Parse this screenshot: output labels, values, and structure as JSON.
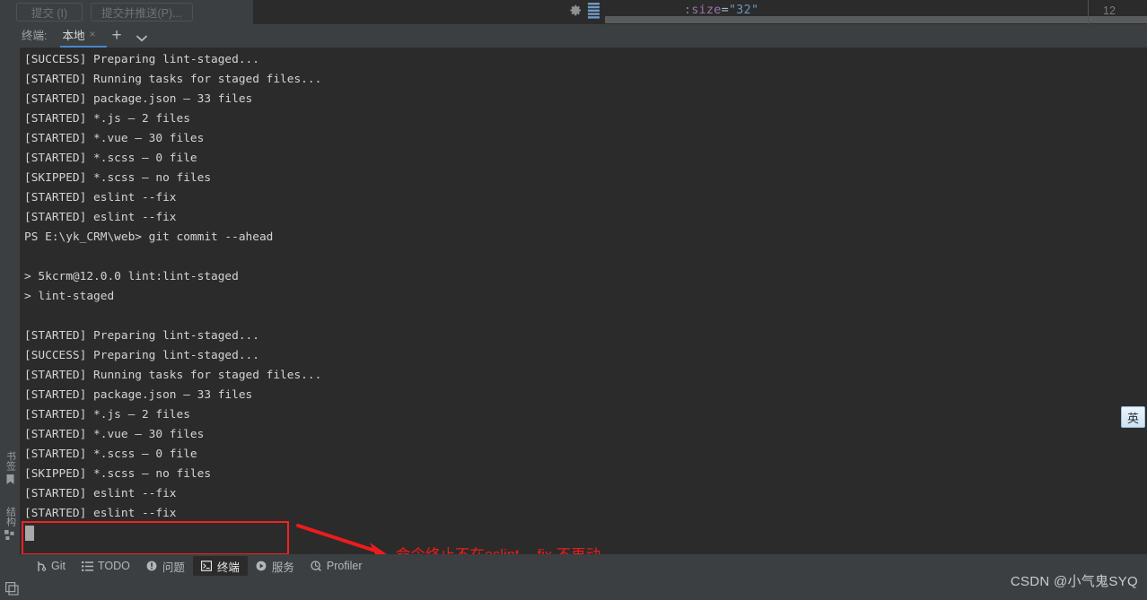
{
  "commit_panel": {
    "commit_button": "提交 (I)",
    "commit_push_button": "提交并推送(P)..."
  },
  "editor_sliver": {
    "gear_icon": "gear-icon",
    "lines_icon": "lines-icon",
    "code": {
      "attr": ":size",
      "equals": "=",
      "value": "\"32\""
    },
    "right_count": "12"
  },
  "terminal_tabs": {
    "tool_label": "终端:",
    "tab_name": "本地",
    "close_glyph": "×",
    "plus_glyph": "+",
    "chevron_icon": "chevron-down-icon"
  },
  "left_rail": {
    "items": [
      {
        "label": "书签",
        "icon": "bookmark-icon"
      },
      {
        "label": "结构",
        "icon": "structure-icon"
      }
    ]
  },
  "terminal": {
    "lines": [
      "[SUCCESS] Preparing lint-staged...",
      "[STARTED] Running tasks for staged files...",
      "[STARTED] package.json — 33 files",
      "[STARTED] *.js — 2 files",
      "[STARTED] *.vue — 30 files",
      "[STARTED] *.scss — 0 file",
      "[SKIPPED] *.scss — no files",
      "[STARTED] eslint --fix",
      "[STARTED] eslint --fix",
      "PS E:\\yk_CRM\\web> git commit --ahead",
      "",
      "> 5kcrm@12.0.0 lint:lint-staged",
      "> lint-staged",
      "",
      "[STARTED] Preparing lint-staged...",
      "[SUCCESS] Preparing lint-staged...",
      "[STARTED] Running tasks for staged files...",
      "[STARTED] package.json — 33 files",
      "[STARTED] *.js — 2 files",
      "[STARTED] *.vue — 30 files",
      "[STARTED] *.scss — 0 file",
      "[SKIPPED] *.scss — no files",
      "[STARTED] eslint --fix",
      "[STARTED] eslint --fix"
    ]
  },
  "annotation": {
    "text": "命令终止不在eslint -- fix 不再动",
    "color": "#ec1c1c",
    "box_color": "#f42222"
  },
  "status_bar": {
    "items": [
      {
        "label": "Git",
        "icon": "git-branch-icon",
        "active": false
      },
      {
        "label": "TODO",
        "icon": "list-icon",
        "active": false
      },
      {
        "label": "问题",
        "icon": "warning-icon",
        "active": false
      },
      {
        "label": "终端",
        "icon": "terminal-icon",
        "active": true
      },
      {
        "label": "服务",
        "icon": "play-circle-icon",
        "active": false
      },
      {
        "label": "Profiler",
        "icon": "profiler-icon",
        "active": false
      }
    ]
  },
  "ime_badge": {
    "label": "英"
  },
  "bottom": {
    "window_icon": "windows-layers-icon",
    "watermark": "CSDN @小气鬼SYQ"
  }
}
